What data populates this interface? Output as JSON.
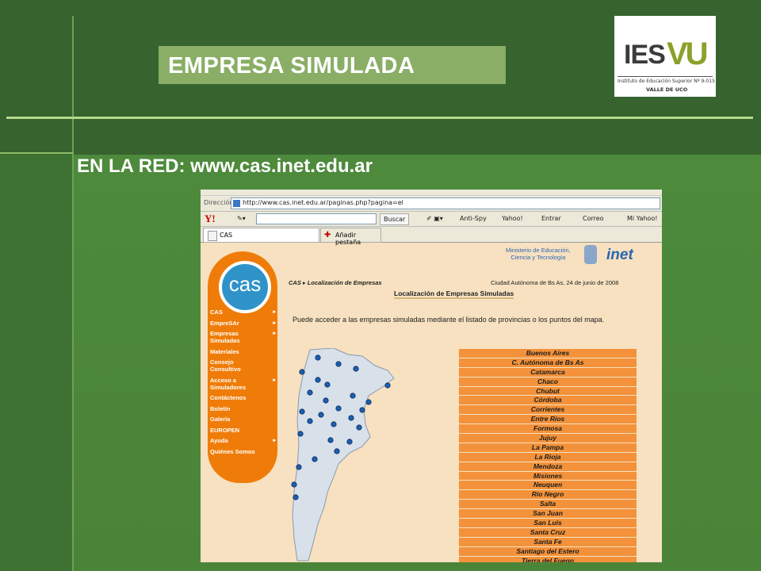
{
  "slide": {
    "title": "EMPRESA SIMULADA",
    "subtitle": "EN LA RED: www.cas.inet.edu.ar",
    "logo": {
      "ies": "IES",
      "vu": "VU",
      "line1": "Instituto de Educación Superior Nº 9-015",
      "line2": "VALLE DE UCO"
    }
  },
  "browser": {
    "address_label": "Dirección",
    "url": "http://www.cas.inet.edu.ar/paginas.php?pagina=el",
    "toolbar": {
      "yahoo_logo": "Y!",
      "buscar": "Buscar",
      "antispy": "Anti-Spy",
      "yahoo": "Yahoo!",
      "entrar": "Entrar",
      "correo": "Correo",
      "my_yahoo": "Mi Yahoo!"
    },
    "tab_label": "CAS",
    "add_tab_label": "Añadir pestaña"
  },
  "site": {
    "logo_text": "cas",
    "menu": [
      {
        "label": "CAS",
        "arrow": true
      },
      {
        "label": "EmpreSAr",
        "arrow": true
      },
      {
        "label": "Empresas Simuladas",
        "arrow": true
      },
      {
        "label": "Materiales",
        "arrow": false
      },
      {
        "label": "Consejo Consultivo",
        "arrow": false
      },
      {
        "label": "Acceso a Simuladores",
        "arrow": true
      },
      {
        "label": "Contáctenos",
        "arrow": false
      },
      {
        "label": "Boletín",
        "arrow": false
      },
      {
        "label": "Galería",
        "arrow": false
      },
      {
        "label": "EUROPEN",
        "arrow": false
      },
      {
        "label": "Ayuda",
        "arrow": true
      },
      {
        "label": "Quiénes Somos",
        "arrow": false
      }
    ],
    "ministry_line1": "Ministerio de Educación,",
    "ministry_line2": "Ciencia y Tecnología",
    "inet": "inet",
    "breadcrumb_home": "CAS",
    "breadcrumb_page": "Localización de Empresas",
    "date": "Ciudad Autónoma de Bs As, 24 de junio de 2008",
    "heading": "Localización de Empresas Simuladas",
    "intro": "Puede acceder a las empresas simuladas mediante el listado de provincias o los puntos del mapa.",
    "provinces": [
      "Buenos Aires",
      "C. Autónoma de Bs As",
      "Catamarca",
      "Chaco",
      "Chubut",
      "Córdoba",
      "Corrientes",
      "Entre Ríos",
      "Formosa",
      "Jujuy",
      "La Pampa",
      "La Rioja",
      "Mendoza",
      "Misiones",
      "Neuquen",
      "Río Negro",
      "Salta",
      "San Juan",
      "San Luis",
      "Santa Cruz",
      "Santa Fe",
      "Santiago del Estero",
      "Tierra del Fuego"
    ]
  },
  "colors": {
    "sidebar": "#ef7c08",
    "province_bg": "#f3923a",
    "page_bg": "#f7e1c0",
    "slide_green": "#36632e",
    "title_box": "#8aae66"
  }
}
